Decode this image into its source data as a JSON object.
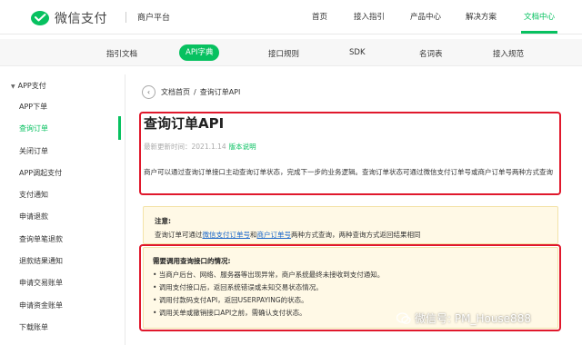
{
  "brand": {
    "name": "微信支付",
    "platform": "商户平台",
    "accent": "#07c160"
  },
  "topnav": [
    "首页",
    "接入指引",
    "产品中心",
    "解决方案",
    "文档中心"
  ],
  "subnav": [
    "指引文档",
    "API字典",
    "接口规则",
    "SDK",
    "名词表",
    "接入规范"
  ],
  "sidebar": {
    "group": "APP支付",
    "items": [
      "APP下单",
      "查询订单",
      "关闭订单",
      "APP调起支付",
      "支付通知",
      "申请退款",
      "查询单笔退款",
      "退款结果通知",
      "申请交易账单",
      "申请资金账单",
      "下载账单"
    ],
    "active_index": 1
  },
  "breadcrumb": {
    "home": "文档首页",
    "sep": "/",
    "current": "查询订单API"
  },
  "article": {
    "title": "查询订单API",
    "updated_prefix": "最新更新时间：",
    "updated_date": "2021.1.14",
    "changelog_link": "版本说明",
    "description": "商户可以通过查询订单接口主动查询订单状态，完成下一步的业务逻辑。查询订单状态可通过微信支付订单号或商户订单号两种方式查询"
  },
  "note": {
    "title": "注意:",
    "text_prefix": "查询订单可通过",
    "link1": "微信支付订单号",
    "and": "和",
    "link2": "商户订单号",
    "text_suffix": "两种方式查询，两种查询方式返回结果相同"
  },
  "scenario": {
    "title": "需要调用查询接口的情况:",
    "items": [
      "• 当商户后台、网络、服务器等出现异常，商户系统最终未接收到支付通知。",
      "• 调用支付接口后，返回系统错误或未知交易状态情况。",
      "• 调用付款码支付API，返回USERPAYING的状态。",
      "• 调用关单或撤销接口API之前，需确认支付状态。"
    ]
  },
  "watermark": "微信号: PM_House888"
}
